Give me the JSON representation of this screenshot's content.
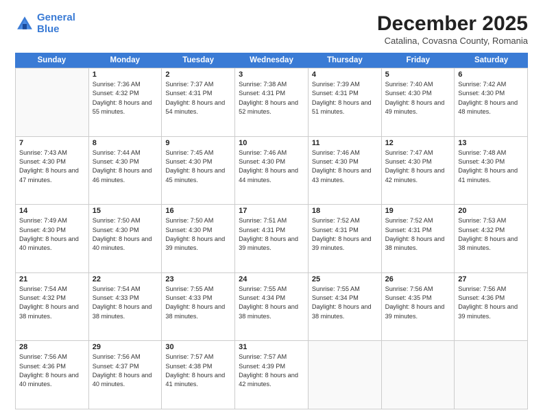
{
  "logo": {
    "line1": "General",
    "line2": "Blue"
  },
  "title": "December 2025",
  "subtitle": "Catalina, Covasna County, Romania",
  "header_days": [
    "Sunday",
    "Monday",
    "Tuesday",
    "Wednesday",
    "Thursday",
    "Friday",
    "Saturday"
  ],
  "weeks": [
    [
      {
        "day": "",
        "sunrise": "",
        "sunset": "",
        "daylight": ""
      },
      {
        "day": "1",
        "sunrise": "Sunrise: 7:36 AM",
        "sunset": "Sunset: 4:32 PM",
        "daylight": "Daylight: 8 hours and 55 minutes."
      },
      {
        "day": "2",
        "sunrise": "Sunrise: 7:37 AM",
        "sunset": "Sunset: 4:31 PM",
        "daylight": "Daylight: 8 hours and 54 minutes."
      },
      {
        "day": "3",
        "sunrise": "Sunrise: 7:38 AM",
        "sunset": "Sunset: 4:31 PM",
        "daylight": "Daylight: 8 hours and 52 minutes."
      },
      {
        "day": "4",
        "sunrise": "Sunrise: 7:39 AM",
        "sunset": "Sunset: 4:31 PM",
        "daylight": "Daylight: 8 hours and 51 minutes."
      },
      {
        "day": "5",
        "sunrise": "Sunrise: 7:40 AM",
        "sunset": "Sunset: 4:30 PM",
        "daylight": "Daylight: 8 hours and 49 minutes."
      },
      {
        "day": "6",
        "sunrise": "Sunrise: 7:42 AM",
        "sunset": "Sunset: 4:30 PM",
        "daylight": "Daylight: 8 hours and 48 minutes."
      }
    ],
    [
      {
        "day": "7",
        "sunrise": "Sunrise: 7:43 AM",
        "sunset": "Sunset: 4:30 PM",
        "daylight": "Daylight: 8 hours and 47 minutes."
      },
      {
        "day": "8",
        "sunrise": "Sunrise: 7:44 AM",
        "sunset": "Sunset: 4:30 PM",
        "daylight": "Daylight: 8 hours and 46 minutes."
      },
      {
        "day": "9",
        "sunrise": "Sunrise: 7:45 AM",
        "sunset": "Sunset: 4:30 PM",
        "daylight": "Daylight: 8 hours and 45 minutes."
      },
      {
        "day": "10",
        "sunrise": "Sunrise: 7:46 AM",
        "sunset": "Sunset: 4:30 PM",
        "daylight": "Daylight: 8 hours and 44 minutes."
      },
      {
        "day": "11",
        "sunrise": "Sunrise: 7:46 AM",
        "sunset": "Sunset: 4:30 PM",
        "daylight": "Daylight: 8 hours and 43 minutes."
      },
      {
        "day": "12",
        "sunrise": "Sunrise: 7:47 AM",
        "sunset": "Sunset: 4:30 PM",
        "daylight": "Daylight: 8 hours and 42 minutes."
      },
      {
        "day": "13",
        "sunrise": "Sunrise: 7:48 AM",
        "sunset": "Sunset: 4:30 PM",
        "daylight": "Daylight: 8 hours and 41 minutes."
      }
    ],
    [
      {
        "day": "14",
        "sunrise": "Sunrise: 7:49 AM",
        "sunset": "Sunset: 4:30 PM",
        "daylight": "Daylight: 8 hours and 40 minutes."
      },
      {
        "day": "15",
        "sunrise": "Sunrise: 7:50 AM",
        "sunset": "Sunset: 4:30 PM",
        "daylight": "Daylight: 8 hours and 40 minutes."
      },
      {
        "day": "16",
        "sunrise": "Sunrise: 7:50 AM",
        "sunset": "Sunset: 4:30 PM",
        "daylight": "Daylight: 8 hours and 39 minutes."
      },
      {
        "day": "17",
        "sunrise": "Sunrise: 7:51 AM",
        "sunset": "Sunset: 4:31 PM",
        "daylight": "Daylight: 8 hours and 39 minutes."
      },
      {
        "day": "18",
        "sunrise": "Sunrise: 7:52 AM",
        "sunset": "Sunset: 4:31 PM",
        "daylight": "Daylight: 8 hours and 39 minutes."
      },
      {
        "day": "19",
        "sunrise": "Sunrise: 7:52 AM",
        "sunset": "Sunset: 4:31 PM",
        "daylight": "Daylight: 8 hours and 38 minutes."
      },
      {
        "day": "20",
        "sunrise": "Sunrise: 7:53 AM",
        "sunset": "Sunset: 4:32 PM",
        "daylight": "Daylight: 8 hours and 38 minutes."
      }
    ],
    [
      {
        "day": "21",
        "sunrise": "Sunrise: 7:54 AM",
        "sunset": "Sunset: 4:32 PM",
        "daylight": "Daylight: 8 hours and 38 minutes."
      },
      {
        "day": "22",
        "sunrise": "Sunrise: 7:54 AM",
        "sunset": "Sunset: 4:33 PM",
        "daylight": "Daylight: 8 hours and 38 minutes."
      },
      {
        "day": "23",
        "sunrise": "Sunrise: 7:55 AM",
        "sunset": "Sunset: 4:33 PM",
        "daylight": "Daylight: 8 hours and 38 minutes."
      },
      {
        "day": "24",
        "sunrise": "Sunrise: 7:55 AM",
        "sunset": "Sunset: 4:34 PM",
        "daylight": "Daylight: 8 hours and 38 minutes."
      },
      {
        "day": "25",
        "sunrise": "Sunrise: 7:55 AM",
        "sunset": "Sunset: 4:34 PM",
        "daylight": "Daylight: 8 hours and 38 minutes."
      },
      {
        "day": "26",
        "sunrise": "Sunrise: 7:56 AM",
        "sunset": "Sunset: 4:35 PM",
        "daylight": "Daylight: 8 hours and 39 minutes."
      },
      {
        "day": "27",
        "sunrise": "Sunrise: 7:56 AM",
        "sunset": "Sunset: 4:36 PM",
        "daylight": "Daylight: 8 hours and 39 minutes."
      }
    ],
    [
      {
        "day": "28",
        "sunrise": "Sunrise: 7:56 AM",
        "sunset": "Sunset: 4:36 PM",
        "daylight": "Daylight: 8 hours and 40 minutes."
      },
      {
        "day": "29",
        "sunrise": "Sunrise: 7:56 AM",
        "sunset": "Sunset: 4:37 PM",
        "daylight": "Daylight: 8 hours and 40 minutes."
      },
      {
        "day": "30",
        "sunrise": "Sunrise: 7:57 AM",
        "sunset": "Sunset: 4:38 PM",
        "daylight": "Daylight: 8 hours and 41 minutes."
      },
      {
        "day": "31",
        "sunrise": "Sunrise: 7:57 AM",
        "sunset": "Sunset: 4:39 PM",
        "daylight": "Daylight: 8 hours and 42 minutes."
      },
      {
        "day": "",
        "sunrise": "",
        "sunset": "",
        "daylight": ""
      },
      {
        "day": "",
        "sunrise": "",
        "sunset": "",
        "daylight": ""
      },
      {
        "day": "",
        "sunrise": "",
        "sunset": "",
        "daylight": ""
      }
    ]
  ]
}
